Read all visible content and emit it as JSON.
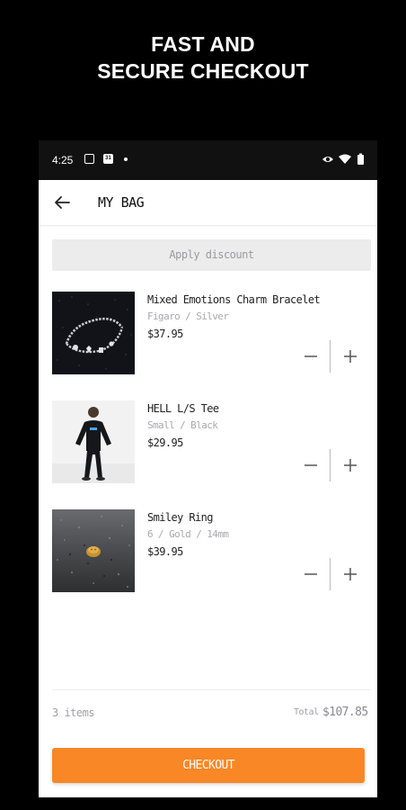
{
  "promo": {
    "line1": "FAST AND",
    "line2": "SECURE CHECKOUT"
  },
  "status_bar": {
    "time": "4:25",
    "calendar_badge": "31",
    "icons": [
      "image-icon",
      "calendar-icon",
      "dot-icon",
      "eye-icon",
      "wifi-icon",
      "battery-icon"
    ]
  },
  "header": {
    "title": "MY BAG",
    "back_icon": "arrow-left-icon"
  },
  "discount": {
    "label": "Apply discount"
  },
  "items": [
    {
      "name": "Mixed Emotions Charm Bracelet",
      "variant": "Figaro / Silver",
      "price": "$37.95"
    },
    {
      "name": "HELL L/S Tee",
      "variant": "Small / Black",
      "price": "$29.95"
    },
    {
      "name": "Smiley Ring",
      "variant": "6 / Gold / 14mm",
      "price": "$39.95"
    }
  ],
  "summary": {
    "count": "3 items",
    "total_label": "Total",
    "total_value": "$107.85"
  },
  "checkout": {
    "label": "CHECKOUT"
  },
  "colors": {
    "accent": "#f98726",
    "background": "#000000",
    "status_bar": "#111111"
  }
}
